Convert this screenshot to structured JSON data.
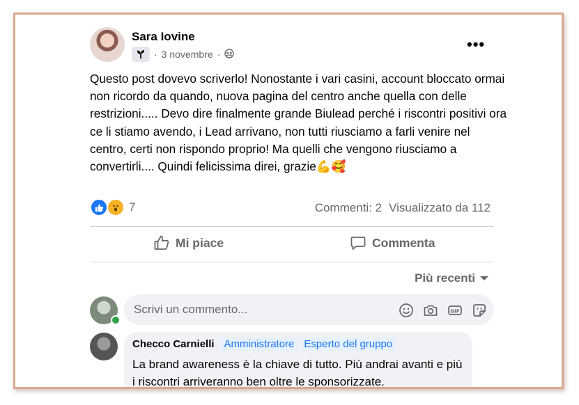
{
  "post": {
    "author": "Sara Iovine",
    "date": "3 novembre",
    "separator1": "·",
    "separator2": "·",
    "privacy_icon": "group-icon",
    "badge_icon": "sprout-icon",
    "more_label": "•••",
    "text": "Questo post dovevo scriverlo! Nonostante i vari casini, account bloccato ormai non ricordo da quando, nuova pagina del centro anche quella con delle restrizioni..... Devo dire finalmente grande Biulead perché i riscontri positivi ora ce li stiamo avendo, i Lead arrivano, non tutti riusciamo a farli venire nel centro, certi non rispondo proprio! Ma quelli che vengono riusciamo a convertirli.... Quindi felicissima direi, grazie",
    "emojis": "💪🥰"
  },
  "reactions": {
    "count": "7",
    "types": [
      "like",
      "wow"
    ],
    "like_color": "#1877f2",
    "wow_color": "#f7b125"
  },
  "stats": {
    "comments": "Commenti: 2",
    "views": "Visualizzato da 112"
  },
  "actions": {
    "like_label": "Mi piace",
    "comment_label": "Commenta"
  },
  "sort": {
    "label": "Più recenti"
  },
  "composer": {
    "placeholder": "Scrivi un commento...",
    "icons": [
      "emoji-icon",
      "camera-icon",
      "gif-icon",
      "sticker-icon"
    ]
  },
  "comment": {
    "author": "Checco Carnielli",
    "badges": [
      "Amministratore",
      "Esperto del gruppo"
    ],
    "text": "La brand awareness è la chiave di tutto. Più andrai avanti e più i riscontri arriveranno ben oltre le sponsorizzate."
  },
  "colors": {
    "frame_border": "#d9a98f",
    "accent": "#1877f2",
    "secondary_text": "#65676b"
  }
}
